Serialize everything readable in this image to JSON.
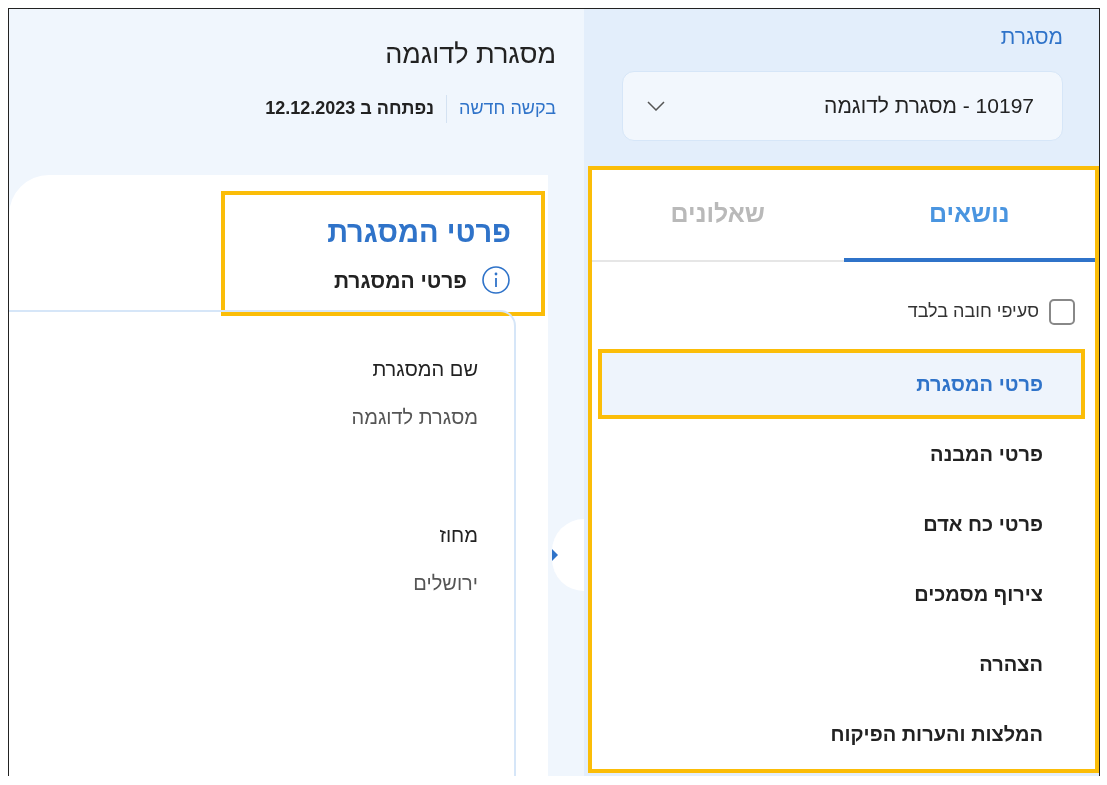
{
  "header": {
    "title": "מסגרת לדוגמה",
    "link": "בקשה חדשה",
    "opened": "נפתחה ב 12.12.2023"
  },
  "section": {
    "title": "פרטי המסגרת",
    "subtitle": "פרטי המסגרת",
    "highlighted": true,
    "fields": [
      {
        "label": "שם המסגרת",
        "value": "מסגרת לדוגמה"
      },
      {
        "label": "מחוז",
        "value": "ירושלים"
      }
    ]
  },
  "sidebar": {
    "label": "מסגרת",
    "select": {
      "value": "10197 - מסגרת לדוגמה"
    },
    "highlighted": true,
    "tabs": [
      {
        "label": "נושאים",
        "selected": true
      },
      {
        "label": "שאלונים",
        "selected": false
      }
    ],
    "filter": {
      "label": "סעיפי חובה בלבד",
      "checked": false
    },
    "topics": [
      {
        "label": "פרטי המסגרת",
        "selected": true,
        "highlighted": true
      },
      {
        "label": "פרטי המבנה",
        "selected": false,
        "highlighted": false
      },
      {
        "label": "פרטי כח אדם",
        "selected": false,
        "highlighted": false
      },
      {
        "label": "צירוף מסמכים",
        "selected": false,
        "highlighted": false
      },
      {
        "label": "הצהרה",
        "selected": false,
        "highlighted": false
      },
      {
        "label": "המלצות והערות הפיקוח",
        "selected": false,
        "highlighted": false
      }
    ]
  }
}
